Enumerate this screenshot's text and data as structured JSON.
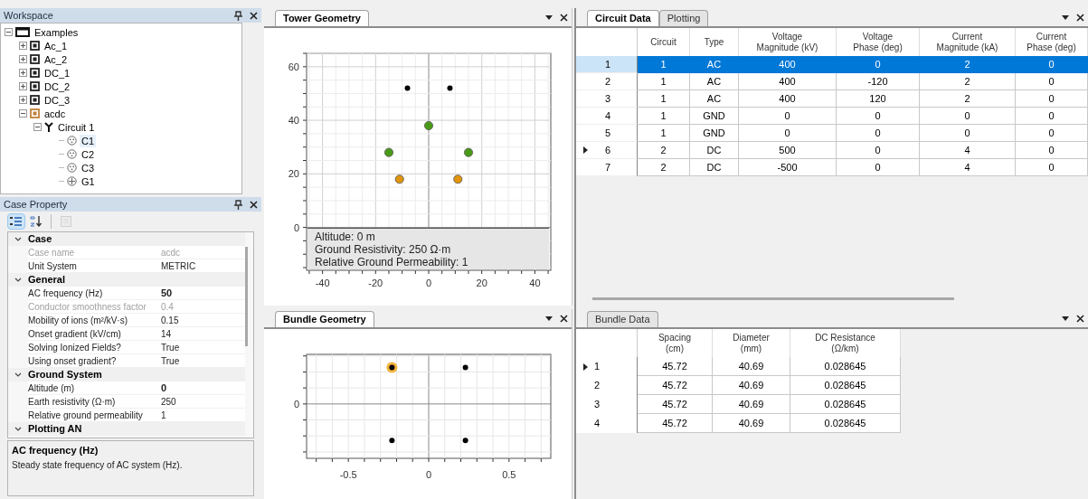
{
  "workspace": {
    "title": "Workspace",
    "tree": [
      {
        "label": "Examples",
        "kind": "folder",
        "expanded": true,
        "children": [
          {
            "label": "Ac_1",
            "kind": "case",
            "expanded": false,
            "active": false
          },
          {
            "label": "Ac_2",
            "kind": "case",
            "expanded": false,
            "active": false
          },
          {
            "label": "DC_1",
            "kind": "case",
            "expanded": false,
            "active": false
          },
          {
            "label": "DC_2",
            "kind": "case",
            "expanded": false,
            "active": false
          },
          {
            "label": "DC_3",
            "kind": "case",
            "expanded": false,
            "active": false
          },
          {
            "label": "acdc",
            "kind": "case",
            "expanded": true,
            "active": true,
            "children": [
              {
                "label": "Circuit 1",
                "kind": "circuit",
                "expanded": true,
                "children": [
                  {
                    "label": "C1",
                    "kind": "conductor",
                    "selected": true
                  },
                  {
                    "label": "C2",
                    "kind": "conductor",
                    "selected": false
                  },
                  {
                    "label": "C3",
                    "kind": "conductor",
                    "selected": false
                  },
                  {
                    "label": "G1",
                    "kind": "ground",
                    "selected": false
                  }
                ]
              }
            ]
          }
        ]
      }
    ]
  },
  "case_property": {
    "title": "Case Property",
    "toolbar": [
      {
        "kind": "categorized",
        "selected": true,
        "disabled": false
      },
      {
        "kind": "alphabetical",
        "selected": false,
        "disabled": false
      },
      {
        "kind": "pages",
        "selected": false,
        "disabled": true
      }
    ],
    "categories": [
      {
        "name": "Case",
        "expanded": true,
        "properties": [
          {
            "name": "Case name",
            "value": "acdc",
            "disabled": true,
            "modified": false
          },
          {
            "name": "Unit System",
            "value": "METRIC",
            "disabled": false,
            "modified": false
          }
        ]
      },
      {
        "name": "General",
        "expanded": true,
        "properties": [
          {
            "name": "AC frequency (Hz)",
            "value": "50",
            "disabled": false,
            "modified": true
          },
          {
            "name": "Conductor smoothness factor",
            "value": "0.4",
            "disabled": true,
            "modified": false
          },
          {
            "name": "Mobility of ions (m²/kV·s)",
            "value": "0.15",
            "disabled": false,
            "modified": false
          },
          {
            "name": "Onset gradient (kV/cm)",
            "value": "14",
            "disabled": false,
            "modified": false
          },
          {
            "name": "Solving Ionized Fields?",
            "value": "True",
            "disabled": false,
            "modified": false
          },
          {
            "name": "Using onset gradient?",
            "value": "True",
            "disabled": false,
            "modified": false
          }
        ]
      },
      {
        "name": "Ground System",
        "expanded": true,
        "properties": [
          {
            "name": "Altitude (m)",
            "value": "0",
            "disabled": false,
            "modified": true
          },
          {
            "name": "Earth resistivity (Ω·m)",
            "value": "250",
            "disabled": false,
            "modified": false
          },
          {
            "name": "Relative ground permeability",
            "value": "1",
            "disabled": false,
            "modified": false
          }
        ]
      },
      {
        "name": "Plotting AN",
        "expanded": true
      }
    ],
    "description": {
      "title": "AC frequency (Hz)",
      "text": "Steady state frequency of AC system (Hz)."
    }
  },
  "tower_geometry": {
    "tab": "Tower Geometry",
    "chart_data": {
      "type": "scatter",
      "grid": true,
      "xlim": [
        -46,
        46
      ],
      "ylim": [
        -16,
        65
      ],
      "xticks": [
        -40,
        -20,
        0,
        20,
        40
      ],
      "yticks": [
        0,
        20,
        40,
        60
      ],
      "series": [
        {
          "color": "#000000",
          "x": [
            -8,
            8
          ],
          "values": [
            52,
            52
          ]
        },
        {
          "color": "#4a9a1a",
          "x": [
            0,
            -15,
            15
          ],
          "values": [
            38,
            28,
            28
          ]
        },
        {
          "color": "#e0940a",
          "x": [
            -11,
            11
          ],
          "values": [
            18,
            18
          ]
        }
      ]
    },
    "info": [
      "Altitude: 0 m",
      "Ground Resistivity: 250 Ω·m",
      "Relative Ground Permeability: 1"
    ]
  },
  "bundle_geometry": {
    "tab": "Bundle Geometry",
    "x_tick_labels": [
      "-0.5",
      "0",
      "0.5"
    ],
    "y_tick_labels": [
      "0"
    ]
  },
  "circuit_data": {
    "tabs": [
      {
        "label": "Circuit Data",
        "selected": true
      },
      {
        "label": "Plotting",
        "selected": false
      }
    ],
    "columns": [
      "Circuit",
      "Type",
      "Voltage\nMagnitude (kV)",
      "Voltage\nPhase (deg)",
      "Current\nMagnitude (kA)",
      "Current\nPhase (deg)"
    ],
    "rows": [
      {
        "header": "1",
        "selected": true,
        "current": false,
        "cells": [
          "1",
          "AC",
          "400",
          "0",
          "2",
          "0"
        ]
      },
      {
        "header": "2",
        "selected": false,
        "current": false,
        "cells": [
          "1",
          "AC",
          "400",
          "-120",
          "2",
          "0"
        ]
      },
      {
        "header": "3",
        "selected": false,
        "current": false,
        "cells": [
          "1",
          "AC",
          "400",
          "120",
          "2",
          "0"
        ]
      },
      {
        "header": "4",
        "selected": false,
        "current": false,
        "cells": [
          "1",
          "GND",
          "0",
          "0",
          "0",
          "0"
        ]
      },
      {
        "header": "5",
        "selected": false,
        "current": false,
        "cells": [
          "1",
          "GND",
          "0",
          "0",
          "0",
          "0"
        ]
      },
      {
        "header": "6",
        "selected": false,
        "current": true,
        "cells": [
          "2",
          "DC",
          "500",
          "0",
          "4",
          "0"
        ]
      },
      {
        "header": "7",
        "selected": false,
        "current": false,
        "cells": [
          "2",
          "DC",
          "-500",
          "0",
          "4",
          "0"
        ]
      }
    ]
  },
  "bundle_data": {
    "tab": "Bundle Data",
    "columns": [
      "Spacing\n(cm)",
      "Diameter\n(mm)",
      "DC Resistance\n(Ω/km)"
    ],
    "rows": [
      {
        "header": "1",
        "current": true,
        "cells": [
          "45.72",
          "40.69",
          "0.028645"
        ]
      },
      {
        "header": "2",
        "current": false,
        "cells": [
          "45.72",
          "40.69",
          "0.028645"
        ]
      },
      {
        "header": "3",
        "current": false,
        "cells": [
          "45.72",
          "40.69",
          "0.028645"
        ]
      },
      {
        "header": "4",
        "current": false,
        "cells": [
          "45.72",
          "40.69",
          "0.028645"
        ]
      }
    ]
  }
}
